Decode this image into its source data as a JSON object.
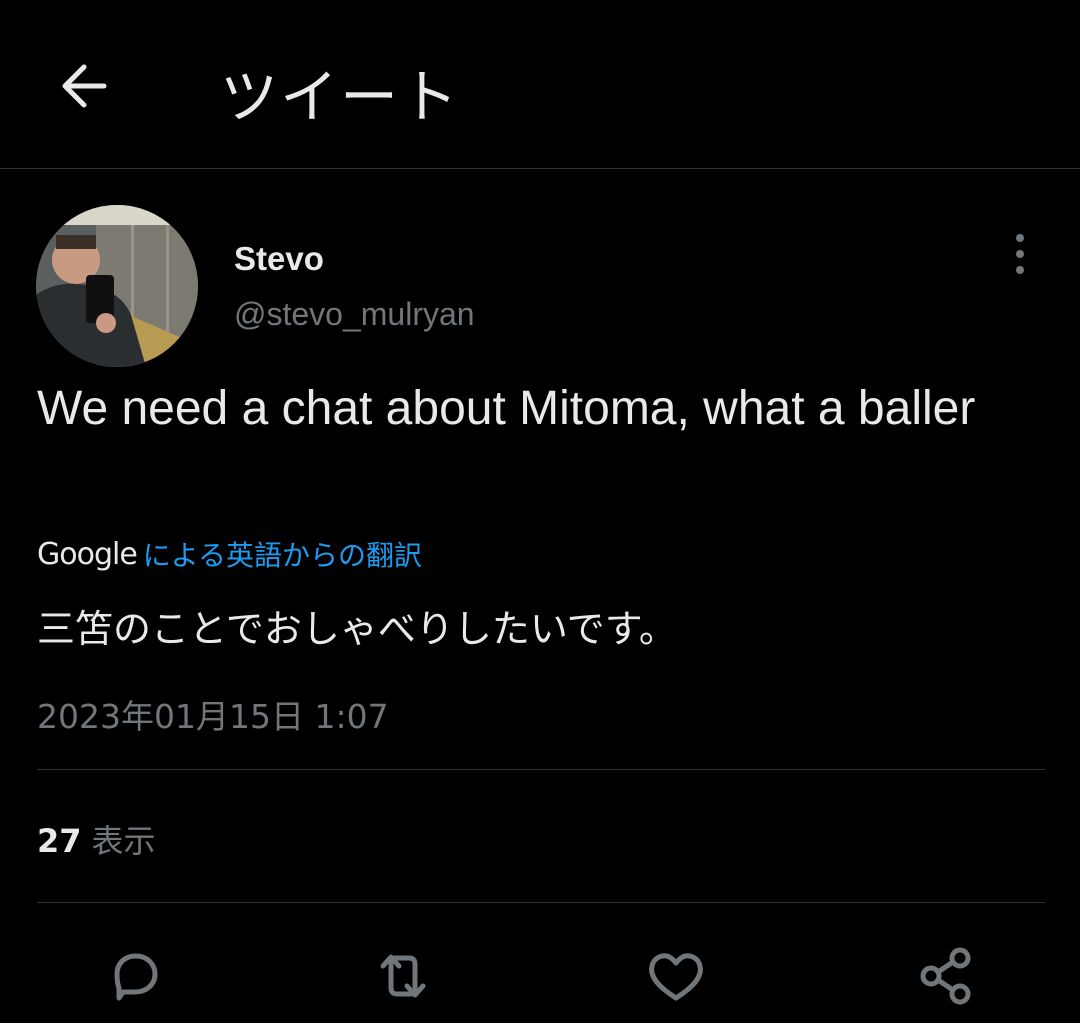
{
  "header": {
    "title": "ツイート"
  },
  "tweet": {
    "display_name": "Stevo",
    "handle": "@stevo_mulryan",
    "text": "We need a chat about Mitoma, what a baller",
    "translation_brand": "Google",
    "translation_label": "による英語からの翻訳",
    "translated_text": "三笘のことでおしゃべりしたいです。",
    "timestamp": "2023年01月15日 1:07"
  },
  "stats": {
    "views_count": "27",
    "views_label": "表示"
  },
  "actions": [
    "reply-icon",
    "retweet-icon",
    "like-icon",
    "share-icon"
  ],
  "colors": {
    "background": "#000000",
    "text": "#e7e9ea",
    "secondary": "#71767b",
    "link": "#1d9bf0",
    "divider": "#2f3336"
  }
}
